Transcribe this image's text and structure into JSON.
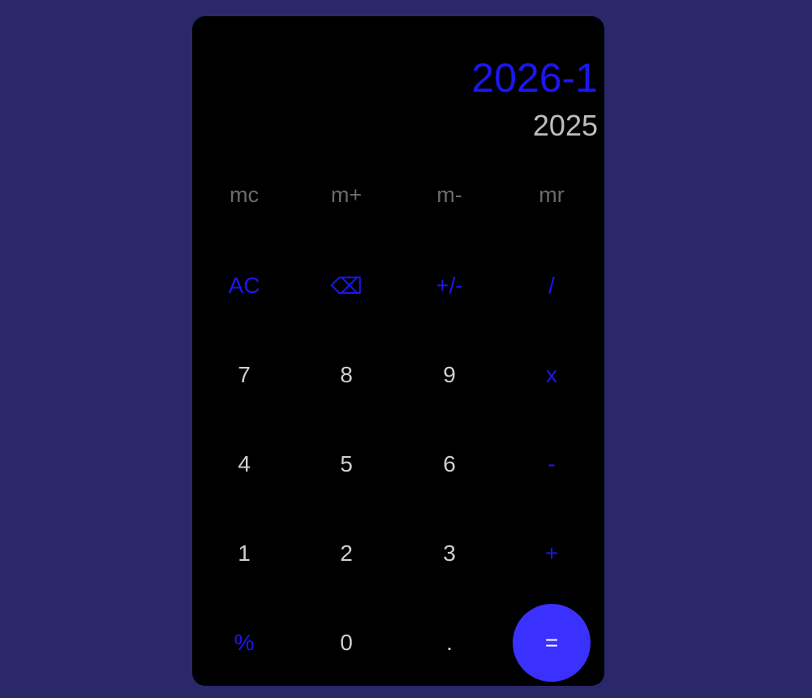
{
  "display": {
    "expression": "2026-1",
    "result": "2025"
  },
  "memory_keys": [
    "mc",
    "m+",
    "m-",
    "mr"
  ],
  "keys": {
    "ac": "AC",
    "backspace": "⌫",
    "sign": "+/-",
    "divide": "/",
    "seven": "7",
    "eight": "8",
    "nine": "9",
    "multiply": "x",
    "four": "4",
    "five": "5",
    "six": "6",
    "minus": "-",
    "one": "1",
    "two": "2",
    "three": "3",
    "plus": "+",
    "percent": "%",
    "zero": "0",
    "decimal": ".",
    "equals": "="
  },
  "colors": {
    "background": "#2a2869",
    "panel": "#000000",
    "accent": "#1c16f2",
    "equals_button": "#3a31ff",
    "digit_text": "#d0d0d0",
    "memory_text": "#6b6b6b",
    "result_text": "#bdbdbd"
  }
}
